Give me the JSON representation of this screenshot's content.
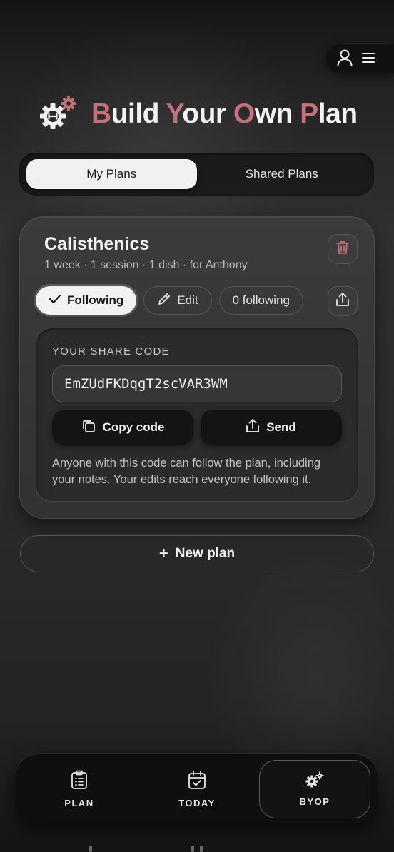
{
  "header": {
    "title_parts": [
      {
        "t": "B",
        "accent": true
      },
      {
        "t": "uild ",
        "accent": false
      },
      {
        "t": "Y",
        "accent": true
      },
      {
        "t": "our ",
        "accent": false
      },
      {
        "t": "O",
        "accent": true
      },
      {
        "t": "wn ",
        "accent": false
      },
      {
        "t": "P",
        "accent": true
      },
      {
        "t": "lan",
        "accent": false
      }
    ],
    "icon": "gears-dumbbell-icon"
  },
  "top_menu": {
    "icons": [
      "user-icon",
      "menu-icon"
    ]
  },
  "tabs": {
    "items": [
      {
        "label": "My Plans",
        "active": true
      },
      {
        "label": "Shared Plans",
        "active": false
      }
    ]
  },
  "plan": {
    "name": "Calisthenics",
    "meta": "1 week · 1 session · 1 dish · for Anthony",
    "following_label": "Following",
    "edit_label": "Edit",
    "followers_label": "0 following",
    "share": {
      "label": "YOUR SHARE CODE",
      "code": "EmZUdFKDqgT2scVAR3WM",
      "copy_label": "Copy code",
      "send_label": "Send",
      "note": "Anyone with this code can follow the plan, including your notes. Your edits reach everyone following it."
    }
  },
  "new_plan": {
    "plus": "+",
    "label": "New plan"
  },
  "nav": {
    "items": [
      {
        "label": "PLAN",
        "icon": "clipboard-icon"
      },
      {
        "label": "TODAY",
        "icon": "calendar-check-icon"
      },
      {
        "label": "BYOP",
        "icon": "gears-icon",
        "active": true
      }
    ]
  },
  "colors": {
    "accent": "#c4717b",
    "background": "#2a2a2a",
    "card": "#363636"
  }
}
